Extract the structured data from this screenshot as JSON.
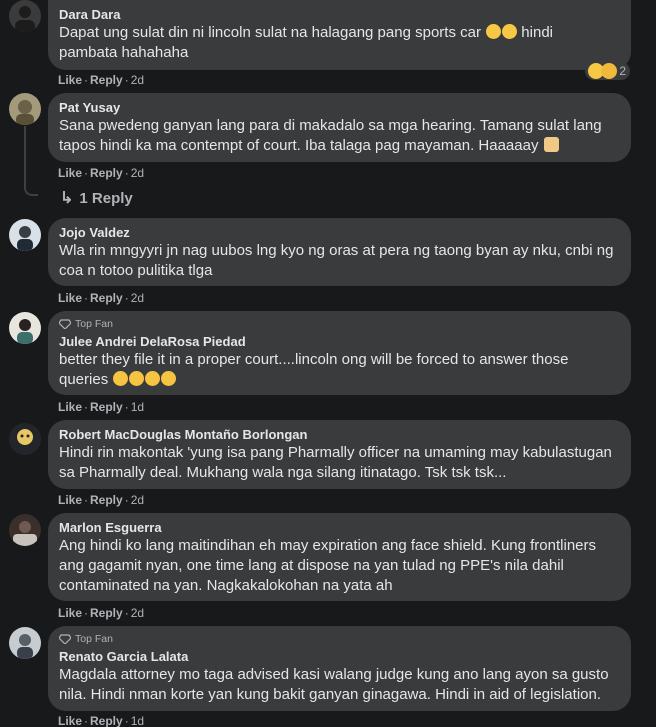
{
  "comments": [
    {
      "author": "Dara Dara",
      "text": "Dapat ung sulat din ni lincoln sulat na halagang pang sports car",
      "text_tail": "hindi\npambata hahahaha",
      "like": "Like",
      "reply": "Reply",
      "time": "2d",
      "reaction_count": "2"
    },
    {
      "author": "Pat Yusay",
      "text": "Sana pwedeng ganyan lang para di makadalo sa mga hearing. Tamang sulat lang\ntapos hindi ka ma contempt of court. Iba talaga pag mayaman. Haaaaay",
      "like": "Like",
      "reply": "Reply",
      "time": "2d",
      "replies_label": "1 Reply"
    },
    {
      "author": "Jojo Valdez",
      "text": "Wla rin mngyyri jn nag uubos lng kyo ng oras at pera ng taong byan ay nku, cnbi ng\ncoa n totoo pulitika tlga",
      "like": "Like",
      "reply": "Reply",
      "time": "2d"
    },
    {
      "badge": "Top Fan",
      "author": "Julee Andrei DelaRosa Piedad",
      "text": "better they file it in a proper court....lincoln ong will be forced to answer those\nqueries",
      "like": "Like",
      "reply": "Reply",
      "time": "1d"
    },
    {
      "author": "Robert MacDouglas Montaño Borlongan",
      "text": "Hindi rin makontak 'yung isa pang Pharmally officer na umaming may kabulastugan\nsa Pharmally deal. Mukhang wala nga silang itinatago. Tsk tsk tsk...",
      "like": "Like",
      "reply": "Reply",
      "time": "2d"
    },
    {
      "author": "Marlon Esguerra",
      "text": "Ang hindi ko lang maitindihan eh may expiration ang face shield. Kung frontliners\nang gagamit nyan, one time lang at dispose na yan tulad ng PPE's nila dahil\ncontaminated na yan. Nagkakalokohan na yata ah",
      "like": "Like",
      "reply": "Reply",
      "time": "2d"
    },
    {
      "badge": "Top Fan",
      "author": "Renato Garcia Lalata",
      "text": "Magdala attorney mo taga advised kasi walang judge kung ano lang ayon sa gusto\nnila. Hindi nman korte yan kung bakit ganyan ginagawa. Hindi in aid of legislation.",
      "like": "Like",
      "reply": "Reply",
      "time": "1d"
    }
  ],
  "colors": {
    "background": "#18191a",
    "bubble": "#3a3b3c",
    "text": "#e4e6eb",
    "muted": "#b0b3b8"
  }
}
